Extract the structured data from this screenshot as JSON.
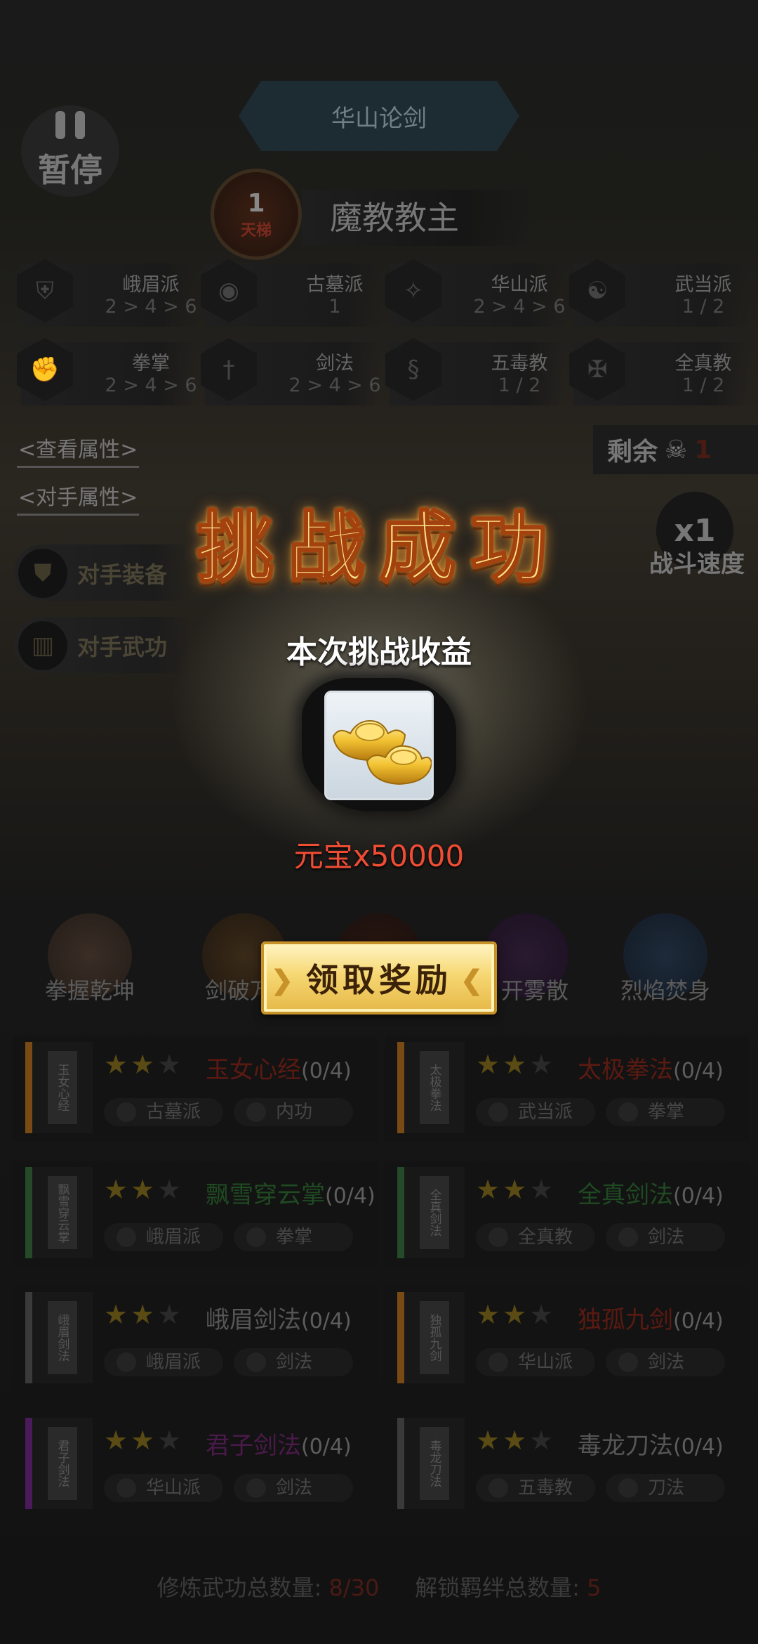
{
  "header": {
    "pause_label": "暂停",
    "mode_title": "华山论剑"
  },
  "boss": {
    "rank": "1",
    "rank_tag": "天梯",
    "name": "魔教教主"
  },
  "factions": [
    {
      "name": "峨眉派",
      "value": "2 > 4 > 6",
      "icon": "emei-icon"
    },
    {
      "name": "古墓派",
      "value": "1",
      "icon": "gumu-icon"
    },
    {
      "name": "华山派",
      "value": "2 > 4 > 6",
      "icon": "huashan-icon"
    },
    {
      "name": "武当派",
      "value": "1 / 2",
      "icon": "wudang-icon"
    },
    {
      "name": "拳掌",
      "value": "2 > 4 > 6",
      "icon": "fist-icon"
    },
    {
      "name": "剑法",
      "value": "2 > 4 > 6",
      "icon": "sword-icon"
    },
    {
      "name": "五毒教",
      "value": "1 / 2",
      "icon": "wudu-icon"
    },
    {
      "name": "全真教",
      "value": "1 / 2",
      "icon": "quanzhen-icon"
    }
  ],
  "links": {
    "view_attributes": "<查看属性>",
    "opponent_attributes": "<对手属性>"
  },
  "remaining": {
    "label": "剩余",
    "count": "1",
    "icon": "skull-icon"
  },
  "speed": {
    "value": "x1",
    "label": "战斗速度"
  },
  "opponent_buttons": [
    {
      "label": "对手装备",
      "icon": "armor-icon"
    },
    {
      "label": "对手武功",
      "icon": "scroll-icon"
    }
  ],
  "skills": [
    {
      "label": "拳握乾坤"
    },
    {
      "label": "剑破万"
    },
    {
      "label": ""
    },
    {
      "label": "开雾散"
    },
    {
      "label": "烈焰焚身"
    }
  ],
  "cards": [
    {
      "name": "玉女心经",
      "progress": "(0/4)",
      "stars": 2,
      "name_color": "#5a1a12",
      "spine_color": "#7a4a14",
      "spine_text": "玉女心经",
      "tags": [
        "古墓派",
        "内功"
      ]
    },
    {
      "name": "太极拳法",
      "progress": "(0/4)",
      "stars": 2,
      "name_color": "#5a1a12",
      "spine_color": "#7a4a14",
      "spine_text": "太极拳法",
      "tags": [
        "武当派",
        "拳掌"
      ]
    },
    {
      "name": "飘雪穿云掌",
      "progress": "(0/4)",
      "stars": 2,
      "name_color": "#1f4a22",
      "spine_color": "#244a2a",
      "spine_text": "飘雪穿云掌",
      "tags": [
        "峨眉派",
        "拳掌"
      ]
    },
    {
      "name": "全真剑法",
      "progress": "(0/4)",
      "stars": 2,
      "name_color": "#1f4a22",
      "spine_color": "#244a2a",
      "spine_text": "全真剑法",
      "tags": [
        "全真教",
        "剑法"
      ]
    },
    {
      "name": "峨眉剑法",
      "progress": "(0/4)",
      "stars": 2,
      "name_color": "#565656",
      "spine_color": "#3a3a3a",
      "spine_text": "峨眉剑法",
      "tags": [
        "峨眉派",
        "剑法"
      ]
    },
    {
      "name": "独孤九剑",
      "progress": "(0/4)",
      "stars": 2,
      "name_color": "#5a1a12",
      "spine_color": "#7a4a14",
      "spine_text": "独孤九剑",
      "tags": [
        "华山派",
        "剑法"
      ]
    },
    {
      "name": "君子剑法",
      "progress": "(0/4)",
      "stars": 2,
      "name_color": "#4a1a4a",
      "spine_color": "#4a1a5a",
      "spine_text": "君子剑法",
      "tags": [
        "华山派",
        "剑法"
      ]
    },
    {
      "name": "毒龙刀法",
      "progress": "(0/4)",
      "stars": 2,
      "name_color": "#565656",
      "spine_color": "#3a3a3a",
      "spine_text": "毒龙刀法",
      "tags": [
        "五毒教",
        "刀法"
      ]
    }
  ],
  "footer": {
    "trained_label": "修炼武功总数量:",
    "trained_value": "8/30",
    "bond_label": "解锁羁绊总数量:",
    "bond_value": "5"
  },
  "overlay": {
    "title": "挑战成功",
    "subtitle": "本次挑战收益",
    "reward_item": "元宝",
    "reward_icon": "gold-ingot-icon",
    "reward_caption": "元宝x50000",
    "claim_label": "领取奖励"
  },
  "colors": {
    "title_gold": "#ffe58a",
    "reward_red": "#ef4c34",
    "button_gold": "#f6d772"
  }
}
